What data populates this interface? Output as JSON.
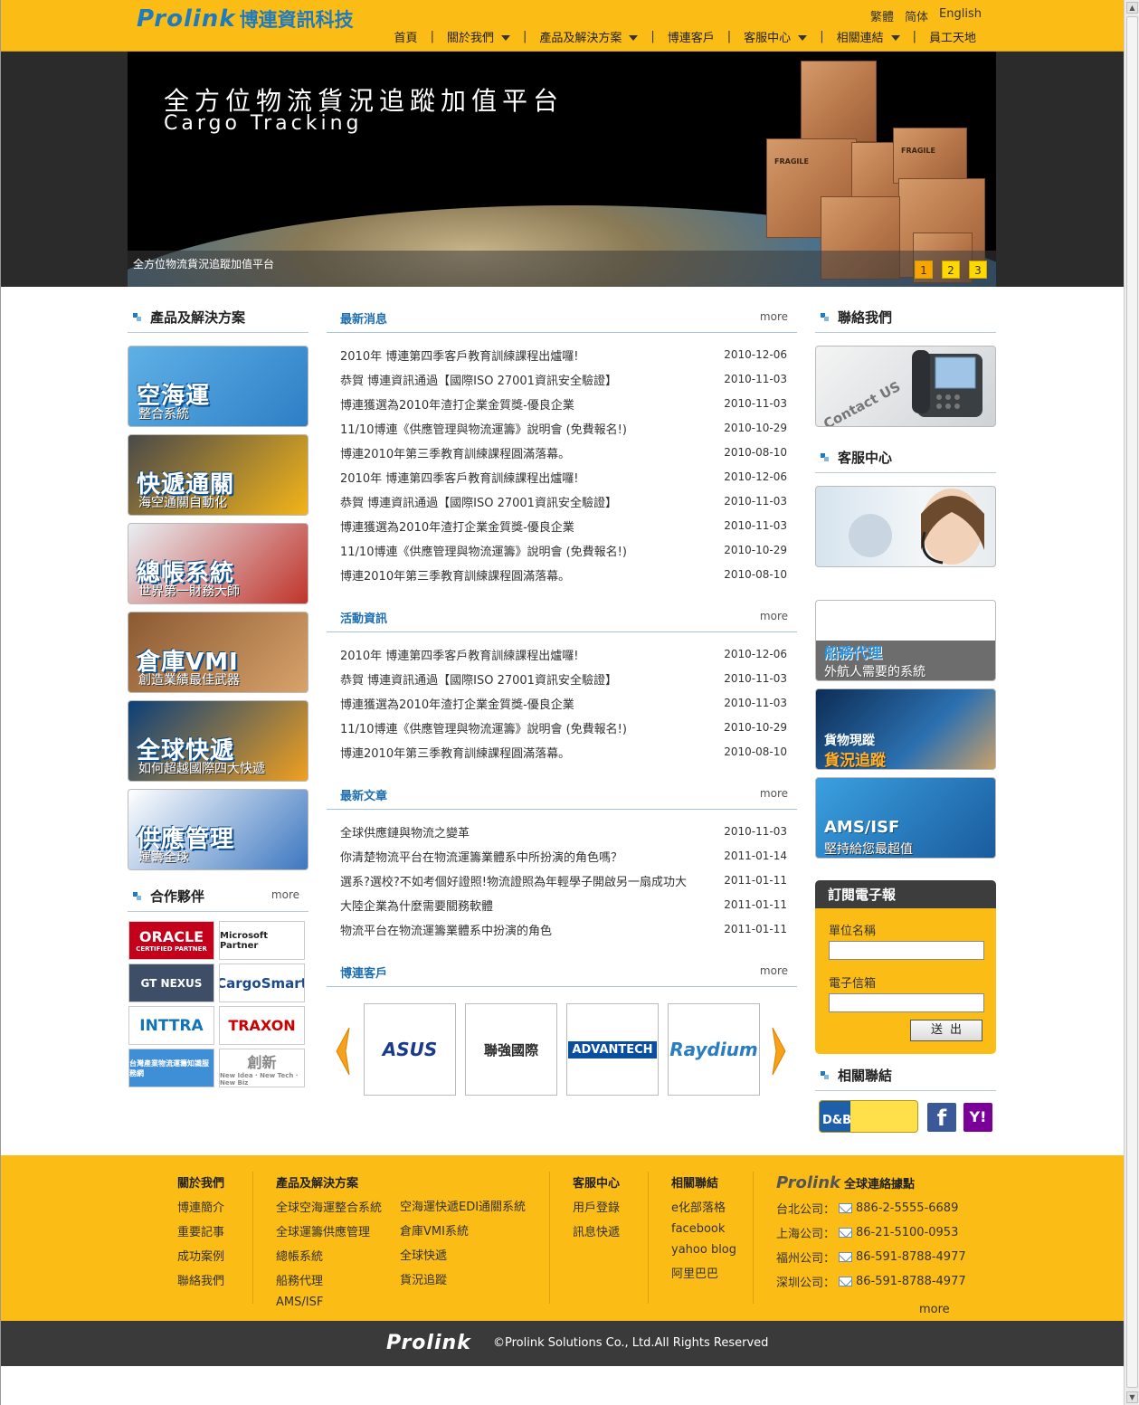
{
  "header": {
    "logo_wordmark": "Prolink",
    "logo_cname": "博連資訊科技",
    "langs": [
      "繁體",
      "简体",
      "English"
    ],
    "nav": [
      {
        "label": "首頁",
        "caret": false
      },
      {
        "label": "關於我們",
        "caret": true
      },
      {
        "label": "產品及解決方案",
        "caret": true
      },
      {
        "label": "博連客戶",
        "caret": false
      },
      {
        "label": "客服中心",
        "caret": true
      },
      {
        "label": "相關連結",
        "caret": true
      },
      {
        "label": "員工天地",
        "caret": false
      }
    ],
    "nav_separator": "|"
  },
  "banner": {
    "title_cn": "全方位物流貨況追蹤加值平台",
    "title_en": "Cargo Tracking",
    "caption": "全方位物流貨況追蹤加值平台",
    "box_label": "FRAGILE",
    "dots": [
      "1",
      "2",
      "3"
    ],
    "active_dot": 0
  },
  "left": {
    "products_title": "產品及解決方案",
    "tiles": [
      {
        "big": "空海運",
        "sub": "整合系統",
        "colors": [
          "#5fb0e6",
          "#2d7fc6"
        ]
      },
      {
        "big": "快遞通關",
        "sub": "海空通關自動化",
        "colors": [
          "#4a4a4a",
          "#f3b419"
        ]
      },
      {
        "big": "總帳系統",
        "sub": "世界第一財務大師",
        "colors": [
          "#e9eef3",
          "#c0342b"
        ]
      },
      {
        "big": "倉庫VMI",
        "sub": "創造業績最佳武器",
        "colors": [
          "#8a5a32",
          "#d8a26a"
        ]
      },
      {
        "big": "全球快遞",
        "sub": "如何超越國際四大快遞",
        "colors": [
          "#0c3f7a",
          "#f0a020"
        ]
      },
      {
        "big": "供應管理",
        "sub": "運籌全球",
        "colors": [
          "#ffffff",
          "#3d77c0"
        ]
      }
    ],
    "partners_title": "合作夥伴",
    "partners_more": "more",
    "partners": [
      {
        "name": "ORACLE",
        "sub": "CERTIFIED PARTNER"
      },
      {
        "name": "Microsoft Partner",
        "sub": ""
      },
      {
        "name": "GT NEXUS",
        "sub": ""
      },
      {
        "name": "CargoSmart",
        "sub": ""
      },
      {
        "name": "INTTRA",
        "sub": ""
      },
      {
        "name": "TRAXON",
        "sub": ""
      },
      {
        "name": "台灣產業物流運籌知識服務網",
        "sub": ""
      },
      {
        "name": "創新",
        "sub": "New Idea · New Tech · New Biz"
      }
    ]
  },
  "middle": {
    "latest_news": {
      "title": "最新消息",
      "more": "more",
      "items": [
        {
          "title": "2010年 博連第四季客戶教育訓練課程出爐囉!",
          "date": "2010-12-06"
        },
        {
          "title": "恭賀 博連資訊通過【國際ISO 27001資訊安全驗證】",
          "date": "2010-11-03"
        },
        {
          "title": "博連獲選為2010年渣打企業金質獎-優良企業",
          "date": "2010-11-03"
        },
        {
          "title": "11/10博連《供應管理與物流運籌》說明會 (免費報名!)",
          "date": "2010-10-29"
        },
        {
          "title": "博連2010年第三季教育訓練課程圓滿落幕。",
          "date": "2010-08-10"
        },
        {
          "title": "2010年 博連第四季客戶教育訓練課程出爐囉!",
          "date": "2010-12-06"
        },
        {
          "title": "恭賀 博連資訊通過【國際ISO 27001資訊安全驗證】",
          "date": "2010-11-03"
        },
        {
          "title": "博連獲選為2010年渣打企業金質獎-優良企業",
          "date": "2010-11-03"
        },
        {
          "title": "11/10博連《供應管理與物流運籌》說明會 (免費報名!)",
          "date": "2010-10-29"
        },
        {
          "title": "博連2010年第三季教育訓練課程圓滿落幕。",
          "date": "2010-08-10"
        }
      ]
    },
    "events": {
      "title": "活動資訊",
      "more": "more",
      "items": [
        {
          "title": "2010年 博連第四季客戶教育訓練課程出爐囉!",
          "date": "2010-12-06"
        },
        {
          "title": "恭賀 博連資訊通過【國際ISO 27001資訊安全驗證】",
          "date": "2010-11-03"
        },
        {
          "title": "博連獲選為2010年渣打企業金質獎-優良企業",
          "date": "2010-11-03"
        },
        {
          "title": "11/10博連《供應管理與物流運籌》說明會 (免費報名!)",
          "date": "2010-10-29"
        },
        {
          "title": "博連2010年第三季教育訓練課程圓滿落幕。",
          "date": "2010-08-10"
        }
      ]
    },
    "articles": {
      "title": "最新文章",
      "more": "more",
      "items": [
        {
          "title": "全球供應鏈與物流之變革",
          "date": "2010-11-03"
        },
        {
          "title": "你清楚物流平台在物流運籌業體系中所扮演的角色嗎？",
          "date": "2011-01-14"
        },
        {
          "title": "選系?選校?不如考個好證照!物流證照為年輕學子開啟另一扇成功大",
          "date": "2011-01-11"
        },
        {
          "title": "大陸企業為什麼需要關務軟體",
          "date": "2011-01-11"
        },
        {
          "title": "物流平台在物流運籌業體系中扮演的角色",
          "date": "2011-01-11"
        }
      ]
    },
    "clients": {
      "title": "博連客戶",
      "more": "more",
      "items": [
        {
          "name": "ASUS",
          "color": "#1a3a8a"
        },
        {
          "name": "聯強國際",
          "color": "#2a2a2a"
        },
        {
          "name": "ADVANTECH",
          "color": "#ffffff"
        },
        {
          "name": "Raydium",
          "color": "#2a7dc0"
        }
      ]
    }
  },
  "right": {
    "contact_title": "聯絡我們",
    "contact_img_text": "Contact US",
    "service_title": "客服中心",
    "tiles": [
      {
        "cap1": "船務代理",
        "cap2": "外航人需要的系統"
      },
      {
        "cap1": "貨物現蹤",
        "cap2": "貨況追蹤"
      },
      {
        "cap1": "AMS/ISF",
        "cap2": "堅持給您最超值"
      }
    ],
    "subscribe": {
      "title": "訂閱電子報",
      "unit_label": "單位名稱",
      "email_label": "電子信箱",
      "submit": "送出"
    },
    "links_title": "相關聯結",
    "links": [
      "D&B",
      "f",
      "Y!"
    ]
  },
  "footer": {
    "about": {
      "title": "關於我們",
      "items": [
        "博連簡介",
        "重要記事",
        "成功案例",
        "聯絡我們"
      ]
    },
    "products": {
      "title": "產品及解決方案",
      "col1": [
        "全球空海運整合系統",
        "全球運籌供應管理",
        "總帳系統",
        "船務代理",
        "AMS/ISF"
      ],
      "col2": [
        "空海運快遞EDI通關系統",
        "倉庫VMI系統",
        "全球快遞",
        "貨況追蹤"
      ]
    },
    "service": {
      "title": "客服中心",
      "items": [
        "用戶登錄",
        "訊息快遞"
      ]
    },
    "links": {
      "title": "相關聯結",
      "items": [
        "e化部落格",
        "facebook",
        "yahoo blog",
        "阿里巴巴"
      ]
    },
    "contact": {
      "logo": "Prolink",
      "title": "全球連絡據點",
      "items": [
        {
          "city": "台北公司：",
          "phone": "886-2-5555-6689"
        },
        {
          "city": "上海公司：",
          "phone": "86-21-5100-0953"
        },
        {
          "city": "福州公司：",
          "phone": "86-591-8788-4977"
        },
        {
          "city": "深圳公司：",
          "phone": "86-591-8788-4977"
        }
      ],
      "more": "more"
    }
  },
  "bottom": {
    "logo": "Prolink",
    "copyright": "©Prolink Solutions Co., Ltd.All Rights Reserved"
  }
}
